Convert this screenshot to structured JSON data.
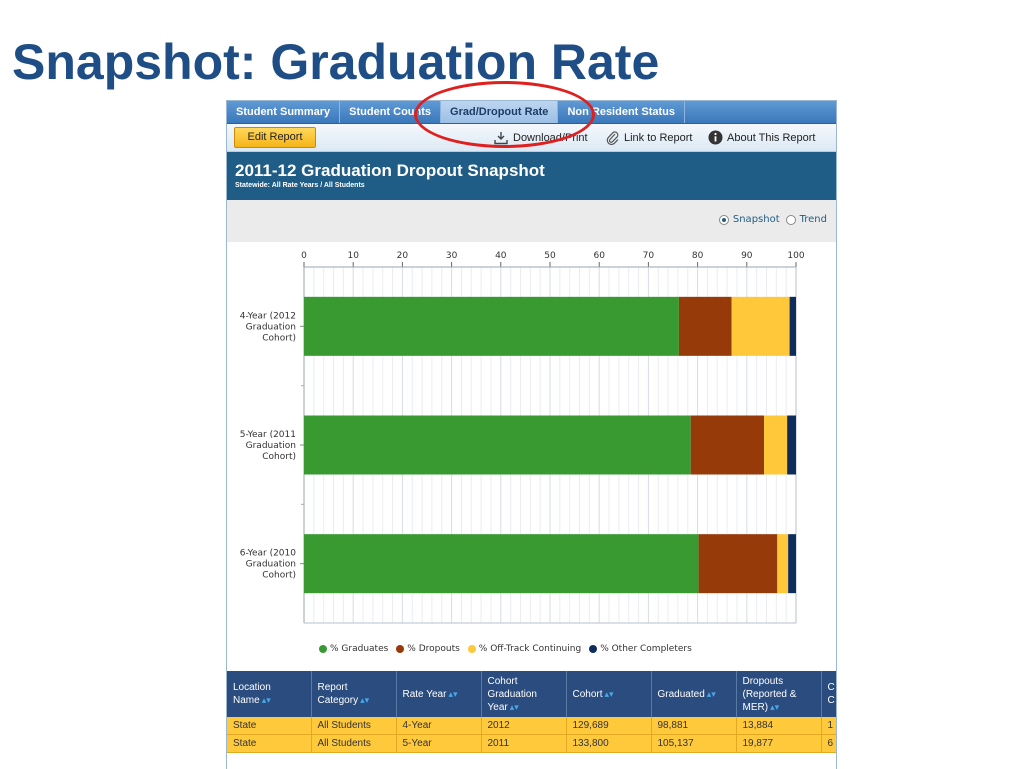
{
  "slide_title": "Snapshot: Graduation Rate",
  "tabs": [
    "Student Summary",
    "Student Counts",
    "Grad/Dropout Rate",
    "Non Resident Status"
  ],
  "toolbar": {
    "edit_label": "Edit Report",
    "download_label": "Download/Print",
    "link_label": "Link to Report",
    "about_label": "About This Report"
  },
  "report": {
    "title": "2011-12 Graduation Dropout Snapshot",
    "subtitle": "Statewide: All Rate Years / All Students"
  },
  "view_toggle": {
    "snapshot": "Snapshot",
    "trend": "Trend",
    "selected": "Snapshot"
  },
  "colors": {
    "graduates": "#3a9a32",
    "dropouts": "#963a0a",
    "offtrack": "#fec83a",
    "other": "#0f2d5c",
    "header": "#1f5d86",
    "accent_circle": "#e01f1f"
  },
  "chart_data": {
    "type": "bar",
    "orientation": "horizontal",
    "stacked": true,
    "categories": [
      [
        "4-Year (2012",
        "Graduation",
        "Cohort)"
      ],
      [
        "5-Year (2011",
        "Graduation",
        "Cohort)"
      ],
      [
        "6-Year (2010",
        "Graduation",
        "Cohort)"
      ]
    ],
    "series": [
      {
        "name": "% Graduates",
        "values": [
          76.2,
          78.6,
          80.2
        ]
      },
      {
        "name": "% Dropouts",
        "values": [
          10.7,
          14.9,
          16.0
        ]
      },
      {
        "name": "% Off-Track Continuing",
        "values": [
          11.8,
          4.7,
          2.2
        ]
      },
      {
        "name": "% Other Completers",
        "values": [
          1.3,
          1.8,
          1.6
        ]
      }
    ],
    "xlim": [
      0,
      100
    ],
    "xticks": [
      0,
      10,
      20,
      30,
      40,
      50,
      60,
      70,
      80,
      90,
      100
    ],
    "grid": true,
    "legend": "bottom"
  },
  "table": {
    "headers": [
      [
        "Location",
        "Name"
      ],
      [
        "Report",
        "Category"
      ],
      [
        "Rate Year"
      ],
      [
        "Cohort",
        "Graduation",
        "Year"
      ],
      [
        "Cohort"
      ],
      [
        "Graduated"
      ],
      [
        "Dropouts",
        "(Reported &",
        "MER)"
      ],
      [
        "C",
        "C"
      ]
    ],
    "rows": [
      [
        "State",
        "All Students",
        "4-Year",
        "2012",
        "129,689",
        "98,881",
        "13,884",
        "1"
      ],
      [
        "State",
        "All Students",
        "5-Year",
        "2011",
        "133,800",
        "105,137",
        "19,877",
        "6"
      ]
    ]
  }
}
